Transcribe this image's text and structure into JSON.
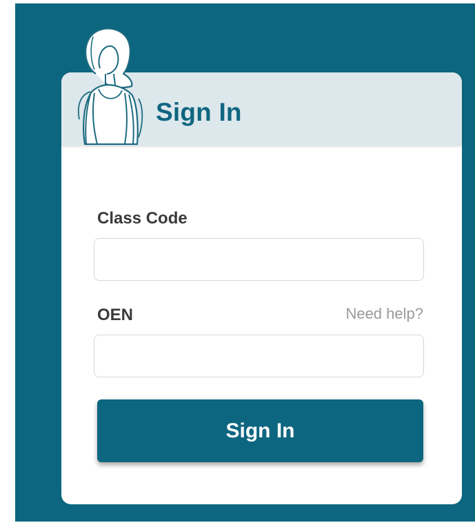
{
  "header": {
    "title": "Sign In",
    "mascot_icon": "student-with-backpack-illustration"
  },
  "form": {
    "class_code": {
      "label": "Class Code",
      "value": "",
      "placeholder": ""
    },
    "oen": {
      "label": "OEN",
      "value": "",
      "placeholder": "",
      "help_link": "Need help?"
    },
    "submit_label": "Sign In"
  },
  "colors": {
    "background": "#0d6680",
    "card": "#ffffff",
    "header": "#dde8ec",
    "accent": "#0f6680",
    "button": "#0d6680"
  }
}
